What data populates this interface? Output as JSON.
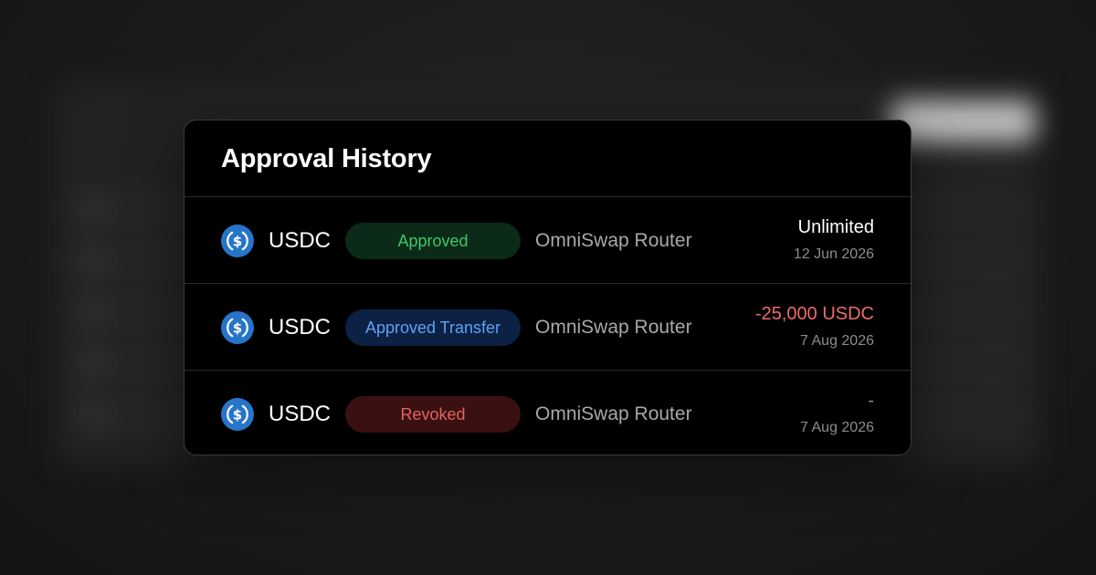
{
  "card": {
    "title": "Approval History"
  },
  "rows": [
    {
      "token": "USDC",
      "token_icon": "usdc-icon",
      "status": "Approved",
      "status_color": "#3ec66a",
      "spender": "OmniSwap Router",
      "amount": "Unlimited",
      "date": "12 Jun 2026"
    },
    {
      "token": "USDC",
      "token_icon": "usdc-icon",
      "status": "Approved Transfer",
      "status_color": "#5fa2f2",
      "spender": "OmniSwap Router",
      "amount": "-25,000 USDC",
      "date": "7 Aug 2026"
    },
    {
      "token": "USDC",
      "token_icon": "usdc-icon",
      "status": "Revoked",
      "status_color": "#e26464",
      "spender": "OmniSwap Router",
      "amount": "-",
      "date": "7 Aug 2026"
    }
  ],
  "colors": {
    "usdc_blue": "#2775ca",
    "negative_amount": "#ef6b6b"
  }
}
